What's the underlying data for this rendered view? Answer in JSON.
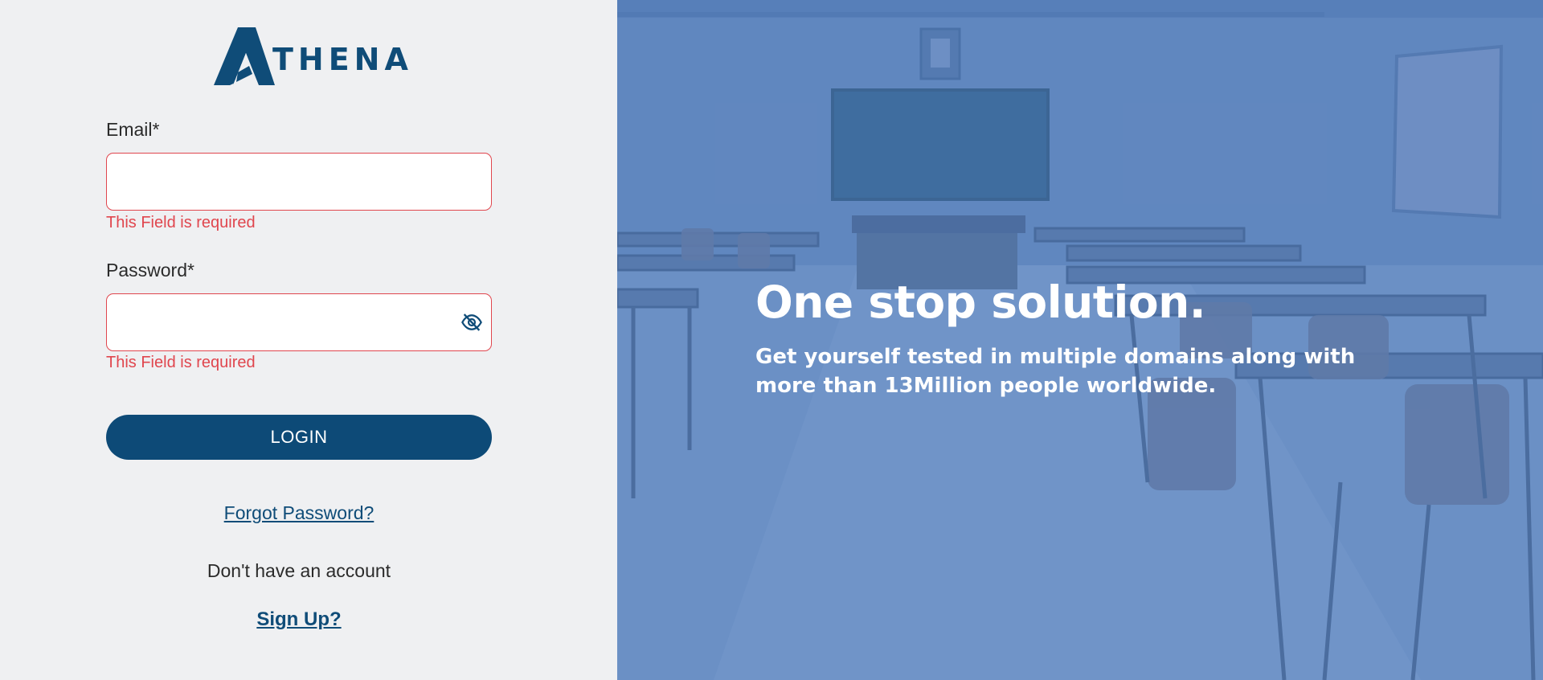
{
  "brand": {
    "name": "THENA",
    "color": "#0f4c78"
  },
  "form": {
    "email_label": "Email*",
    "email_value": "",
    "email_error": "This Field is required",
    "password_label": "Password*",
    "password_value": "",
    "password_error": "This Field is required",
    "password_toggle_icon": "eye-slash-icon",
    "login_label": "LOGIN",
    "forgot_label": "Forgot Password?",
    "no_account_text": "Don't have an account",
    "signup_label": "Sign Up?"
  },
  "hero": {
    "title": "One stop solution.",
    "subtitle": "Get yourself tested in multiple domains along with more than 13Million people worldwide."
  },
  "colors": {
    "primary": "#0d4a77",
    "error": "#e0464e",
    "panel_bg": "#eff0f2"
  }
}
